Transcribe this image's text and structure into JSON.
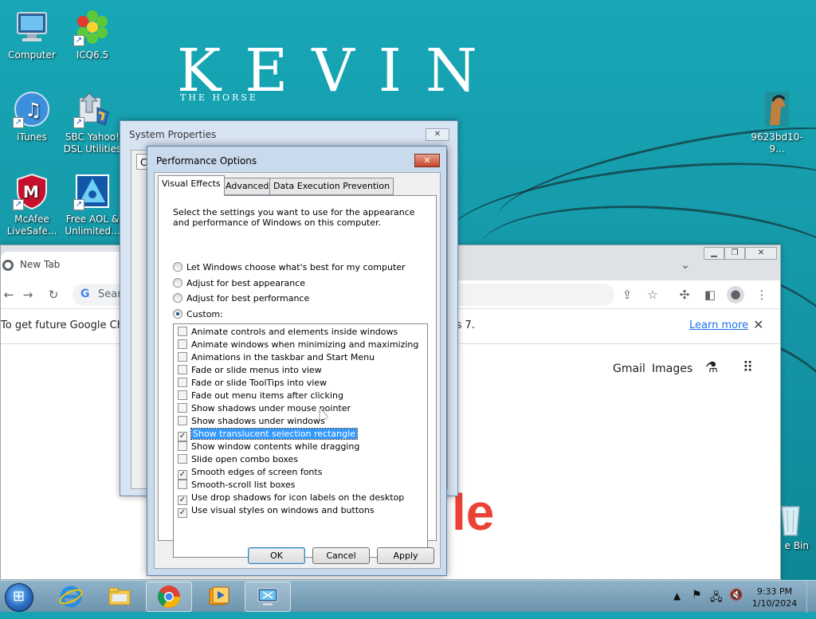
{
  "desktop": {
    "wallpaper_title": "KEVIN",
    "wallpaper_subtitle": "THE HORSE",
    "icons": [
      {
        "label": "Computer",
        "icon": "computer-icon"
      },
      {
        "label": "ICQ6.5",
        "icon": "icq-flower-icon"
      },
      {
        "label": "iTunes",
        "icon": "itunes-icon"
      },
      {
        "label": "SBC Yahoo! DSL Utilities",
        "icon": "sbc-yahoo-icon"
      },
      {
        "label": "McAfee LiveSafe...",
        "icon": "mcafee-icon"
      },
      {
        "label": "Free AOL & Unlimited...",
        "icon": "aol-icon"
      },
      {
        "label": "9623bd10-9...",
        "icon": "horse-image-icon"
      },
      {
        "label": "e Bin",
        "icon": "recycle-bin-icon"
      }
    ]
  },
  "chrome": {
    "tab_title": "New Tab",
    "omnibox_placeholder": "Sear",
    "infobar_text": "To get future Google Chrom",
    "infobar_text_tail": "ws 7.",
    "learn_more": "Learn more",
    "gmail": "Gmail",
    "images": "Images",
    "logo_tail": "le"
  },
  "system_properties": {
    "title": "System Properties",
    "tab_fragment": "Co"
  },
  "performance_options": {
    "title": "Performance Options",
    "tabs": [
      "Visual Effects",
      "Advanced",
      "Data Execution Prevention"
    ],
    "active_tab": "Visual Effects",
    "description": "Select the settings you want to use for the appearance and performance of Windows on this computer.",
    "options": [
      {
        "label": "Let Windows choose what's best for my computer",
        "selected": false
      },
      {
        "label": "Adjust for best appearance",
        "selected": false
      },
      {
        "label": "Adjust for best performance",
        "selected": false
      },
      {
        "label": "Custom:",
        "selected": true
      }
    ],
    "effects": [
      {
        "label": "Animate controls and elements inside windows",
        "checked": false
      },
      {
        "label": "Animate windows when minimizing and maximizing",
        "checked": false
      },
      {
        "label": "Animations in the taskbar and Start Menu",
        "checked": false
      },
      {
        "label": "Fade or slide menus into view",
        "checked": false
      },
      {
        "label": "Fade or slide ToolTips into view",
        "checked": false
      },
      {
        "label": "Fade out menu items after clicking",
        "checked": false
      },
      {
        "label": "Show shadows under mouse pointer",
        "checked": false
      },
      {
        "label": "Show shadows under windows",
        "checked": false
      },
      {
        "label": "Show translucent selection rectangle",
        "checked": true,
        "highlighted": true
      },
      {
        "label": "Show window contents while dragging",
        "checked": false
      },
      {
        "label": "Slide open combo boxes",
        "checked": false
      },
      {
        "label": "Smooth edges of screen fonts",
        "checked": true
      },
      {
        "label": "Smooth-scroll list boxes",
        "checked": false
      },
      {
        "label": "Use drop shadows for icon labels on the desktop",
        "checked": true
      },
      {
        "label": "Use visual styles on windows and buttons",
        "checked": true
      }
    ],
    "buttons": {
      "ok": "OK",
      "cancel": "Cancel",
      "apply": "Apply"
    }
  },
  "taskbar": {
    "time": "9:33 PM",
    "date": "1/10/2024"
  }
}
